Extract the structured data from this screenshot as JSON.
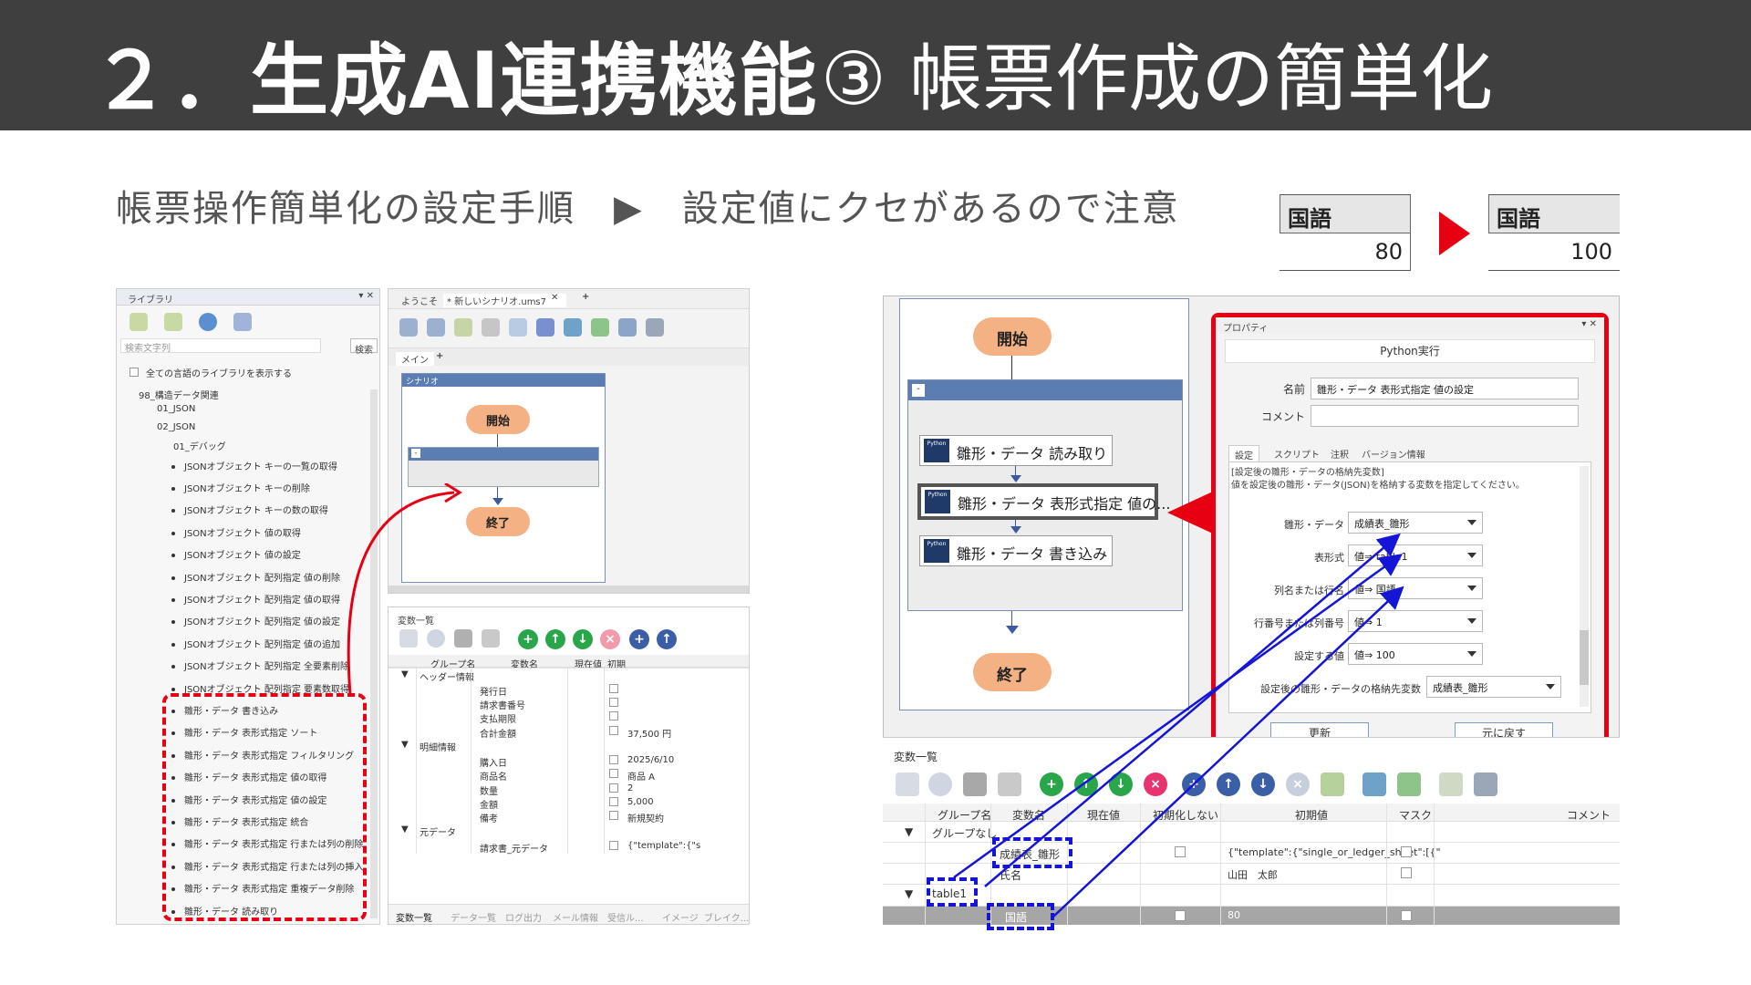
{
  "slide": {
    "title_main": "２．生成AI連携機能",
    "title_sub": "③ 帳票作成の簡単化",
    "subtitle": "帳票操作簡単化の設定手順　▶　設定値にクセがあるので注意"
  },
  "value_change": {
    "before": {
      "header": "国語",
      "value": "80"
    },
    "after": {
      "header": "国語",
      "value": "100"
    }
  },
  "left_screenshot": {
    "library": {
      "title": "ライブラリ",
      "search_placeholder": "検索文字列",
      "search_button": "検索",
      "show_all_label": "全ての言語のライブラリを表示する",
      "tree": [
        "98_構造データ関連",
        "01_JSON",
        "02_JSON",
        "01_デバッグ"
      ],
      "json_items": [
        "JSONオブジェクト キーの一覧の取得",
        "JSONオブジェクト キーの削除",
        "JSONオブジェクト キーの数の取得",
        "JSONオブジェクト 値の取得",
        "JSONオブジェクト 値の設定",
        "JSONオブジェクト 配列指定 値の削除",
        "JSONオブジェクト 配列指定 値の取得",
        "JSONオブジェクト 配列指定 値の設定",
        "JSONオブジェクト 配列指定 値の追加",
        "JSONオブジェクト 配列指定 全要素削除",
        "JSONオブジェクト 配列指定 要素数取得"
      ],
      "template_items": [
        "雛形・データ 書き込み",
        "雛形・データ 表形式指定 ソート",
        "雛形・データ 表形式指定 フィルタリング",
        "雛形・データ 表形式指定 値の取得",
        "雛形・データ 表形式指定 値の設定",
        "雛形・データ 表形式指定 統合",
        "雛形・データ 表形式指定 行または列の削除",
        "雛形・データ 表形式指定 行または列の挿入",
        "雛形・データ 表形式指定 重複データ削除",
        "雛形・データ 読み取り"
      ]
    },
    "editor": {
      "tabs": [
        "ようこそ",
        "* 新しいシナリオ.ums7",
        "+"
      ],
      "sub_tabs": [
        "メイン",
        "+"
      ],
      "scenario_label": "シナリオ",
      "start": "開始",
      "end": "終了",
      "group_label": "-"
    },
    "variables": {
      "title": "変数一覧",
      "columns": [
        "グループ名",
        "変数名",
        "現在値",
        "初期"
      ],
      "groups": [
        {
          "name": "ヘッダー情報",
          "rows": [
            {
              "name": "発行日",
              "value": ""
            },
            {
              "name": "請求書番号",
              "value": ""
            },
            {
              "name": "支払期限",
              "value": ""
            },
            {
              "name": "合計金額",
              "value": "37,500 円"
            }
          ]
        },
        {
          "name": "明細情報",
          "rows": [
            {
              "name": "購入日",
              "value": "2025/6/10"
            },
            {
              "name": "商品名",
              "value": "商品 A"
            },
            {
              "name": "数量",
              "value": "2"
            },
            {
              "name": "金額",
              "value": "5,000"
            },
            {
              "name": "備考",
              "value": "新規契約"
            }
          ]
        },
        {
          "name": "元データ",
          "rows": [
            {
              "name": "請求書_元データ",
              "value": "{\"template\":{\"s"
            }
          ]
        }
      ],
      "bottom_tabs": [
        "変数一覧",
        "データ一覧",
        "ログ出力",
        "メール情報",
        "受信ル...",
        "イメージ",
        "ブレイク..."
      ]
    }
  },
  "right_screenshot": {
    "flow": {
      "start": "開始",
      "end": "終了",
      "group_label": "-",
      "actions": [
        "雛形・データ 読み取り",
        "雛形・データ 表形式指定 値の...",
        "雛形・データ 書き込み"
      ],
      "python_badge": "Python"
    },
    "properties": {
      "title": "プロパティ",
      "heading": "Python実行",
      "name_label": "名前",
      "name_value": "雛形・データ 表形式指定 値の設定",
      "comment_label": "コメント",
      "tabs": [
        "設定",
        "スクリプト",
        "注釈",
        "バージョン情報"
      ],
      "description_1": "[設定後の雛形・データの格納先変数]",
      "description_2": "値を設定後の雛形・データ(JSON)を格納する変数を指定してください。",
      "fields": [
        {
          "label": "雛形・データ",
          "value": "成績表_雛形"
        },
        {
          "label": "表形式",
          "value": "値⇒ table1"
        },
        {
          "label": "列名または行名",
          "value": "値⇒ 国語"
        },
        {
          "label": "行番号または列番号",
          "value": "値⇒ 1"
        },
        {
          "label": "設定する値",
          "value": "値⇒ 100"
        },
        {
          "label": "設定後の雛形・データの格納先変数",
          "value": "成績表_雛形"
        }
      ],
      "update_button": "更新",
      "revert_button": "元に戻す"
    },
    "variables": {
      "title": "変数一覧",
      "columns": [
        "グループ名",
        "変数名",
        "現在値",
        "初期化しない",
        "初期値",
        "マスク",
        "コメント"
      ],
      "rows": [
        {
          "group": "グループなし",
          "name": "",
          "initial": ""
        },
        {
          "group": "",
          "name": "成績表_雛形",
          "initial": "{\"template\":{\"single_or_ledger_sheet\":[{\""
        },
        {
          "group": "",
          "name": "氏名",
          "initial": "山田　太郎"
        },
        {
          "group": "table1",
          "name": "",
          "initial": ""
        },
        {
          "group": "",
          "name": "国語",
          "initial": "80"
        }
      ]
    }
  },
  "colors": {
    "title_band": "#3f3f3f",
    "accent_red": "#e60012",
    "accent_blue": "#1515d8",
    "flow_node": "#f4b183",
    "group_bar": "#5b7db1"
  }
}
